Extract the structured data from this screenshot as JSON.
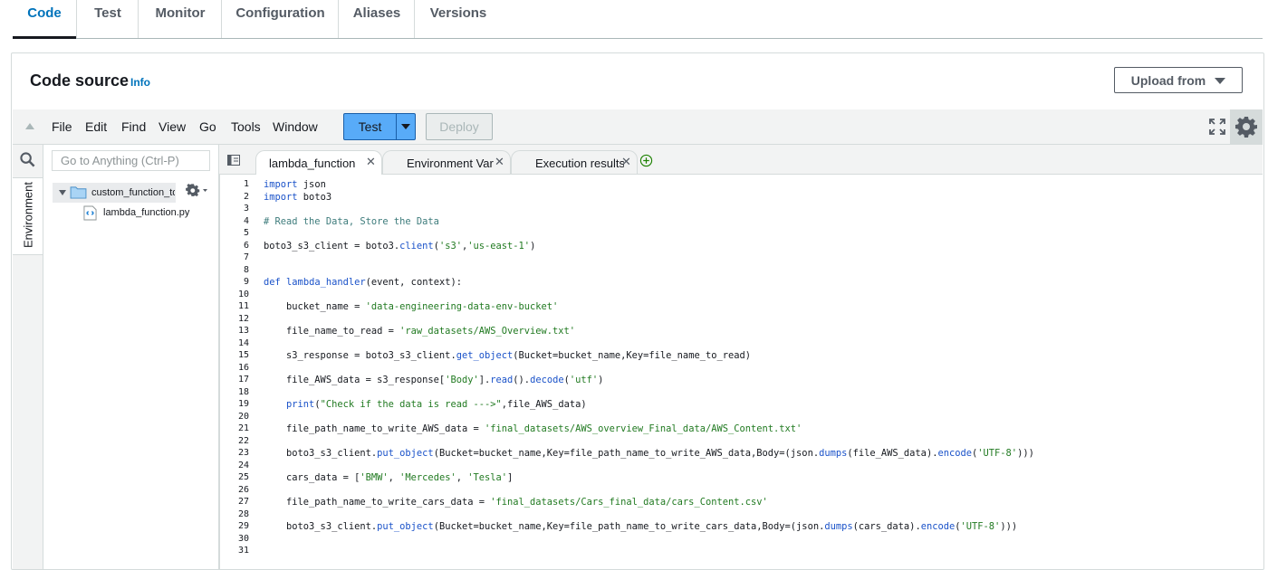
{
  "tabs": [
    {
      "label": "Code",
      "active": true
    },
    {
      "label": "Test"
    },
    {
      "label": "Monitor"
    },
    {
      "label": "Configuration"
    },
    {
      "label": "Aliases"
    },
    {
      "label": "Versions"
    }
  ],
  "panel": {
    "title": "Code source",
    "info_link": "Info",
    "upload_button": "Upload from"
  },
  "ide_toolbar": {
    "menus": [
      "File",
      "Edit",
      "Find",
      "View",
      "Go",
      "Tools",
      "Window"
    ],
    "test_button": "Test",
    "deploy_button": "Deploy",
    "deploy_disabled": true
  },
  "sidebar": {
    "environment_tab": "Environment",
    "search_placeholder": "Go to Anything (Ctrl-P)",
    "folder_name": "custom_function_to",
    "file_name": "lambda_function.py"
  },
  "editor_tabs": [
    {
      "label": "lambda_function",
      "active": true
    },
    {
      "label": "Environment Var"
    },
    {
      "label": "Execution results"
    }
  ],
  "code_lines": [
    "import json",
    "import boto3",
    "",
    "# Read the Data, Store the Data",
    "",
    "boto3_s3_client = boto3.client('s3','us-east-1')",
    "",
    "",
    "def lambda_handler(event, context):",
    "",
    "    bucket_name = 'data-engineering-data-env-bucket'",
    "",
    "    file_name_to_read = 'raw_datasets/AWS_Overview.txt'",
    "",
    "    s3_response = boto3_s3_client.get_object(Bucket=bucket_name,Key=file_name_to_read)",
    "",
    "    file_AWS_data = s3_response['Body'].read().decode('utf')",
    "",
    "    print(\"Check if the data is read --->\",file_AWS_data)",
    "",
    "    file_path_name_to_write_AWS_data = 'final_datasets/AWS_overview_Final_data/AWS_Content.txt'",
    "",
    "    boto3_s3_client.put_object(Bucket=bucket_name,Key=file_path_name_to_write_AWS_data,Body=(json.dumps(file_AWS_data).encode('UTF-8')))",
    "",
    "    cars_data = ['BMW', 'Mercedes', 'Tesla']",
    "",
    "    file_path_name_to_write_cars_data = 'final_datasets/Cars_final_data/cars_Content.csv'",
    "",
    "    boto3_s3_client.put_object(Bucket=bucket_name,Key=file_path_name_to_write_cars_data,Body=(json.dumps(cars_data).encode('UTF-8')))",
    "",
    ""
  ],
  "colors": {
    "accent_link": "#0073bb",
    "test_button": "#58abf8",
    "keyword": "#1a52c9",
    "string": "#217a21",
    "comment": "#3d7b7b"
  },
  "icons": {
    "collapse": "triangle-up-icon",
    "fullscreen": "expand-icon",
    "settings": "gear-icon",
    "search": "search-icon",
    "folder": "folder-icon",
    "file": "python-file-icon",
    "add_tab": "plus-circle-icon"
  }
}
